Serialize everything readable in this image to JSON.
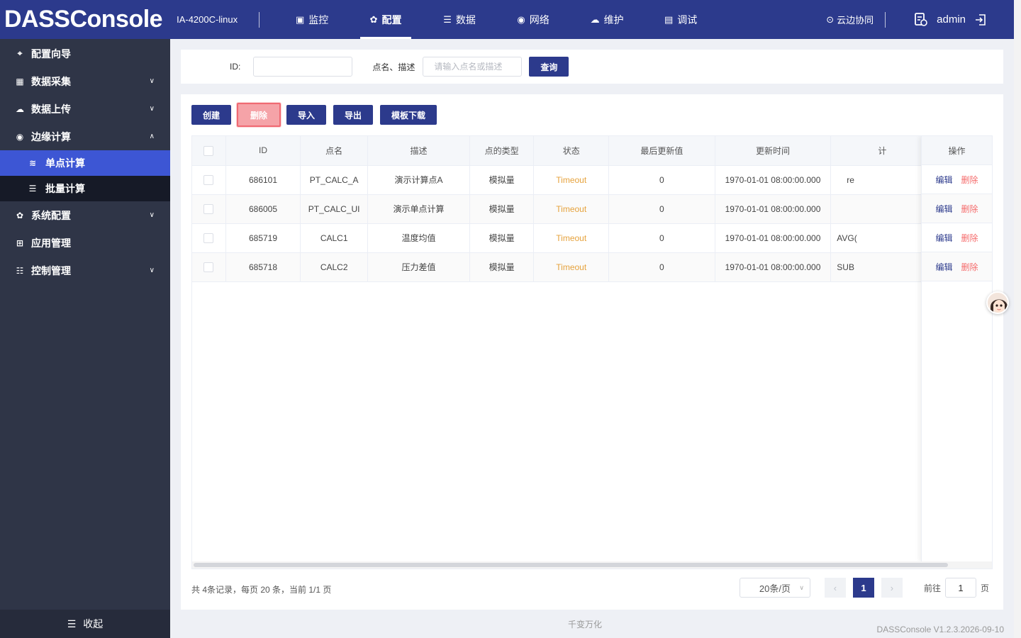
{
  "header": {
    "logo": "DASSConsole",
    "device": "IA-4200C-linux",
    "nav": [
      {
        "label": "监控",
        "icon": "monitor-icon"
      },
      {
        "label": "配置",
        "icon": "config-icon",
        "active": true
      },
      {
        "label": "数据",
        "icon": "database-icon"
      },
      {
        "label": "网络",
        "icon": "network-icon"
      },
      {
        "label": "维护",
        "icon": "maintenance-icon"
      },
      {
        "label": "调试",
        "icon": "debug-icon"
      }
    ],
    "cloud": "云边协同",
    "user": "admin"
  },
  "sidebar": {
    "items": [
      {
        "label": "配置向导",
        "icon": "wizard-icon"
      },
      {
        "label": "数据采集",
        "icon": "collect-icon"
      },
      {
        "label": "数据上传",
        "icon": "upload-icon"
      },
      {
        "label": "边缘计算",
        "icon": "edge-icon",
        "expanded": true
      },
      {
        "label": "单点计算",
        "icon": "single-calc-icon",
        "active": true
      },
      {
        "label": "批量计算",
        "icon": "batch-calc-icon"
      },
      {
        "label": "系统配置",
        "icon": "system-icon"
      },
      {
        "label": "应用管理",
        "icon": "apps-icon"
      },
      {
        "label": "控制管理",
        "icon": "control-icon"
      }
    ],
    "collapse": "收起"
  },
  "filter": {
    "id_label": "ID:",
    "id_value": "",
    "name_label": "点名、描述",
    "name_placeholder": "请输入点名或描述",
    "query": "查询"
  },
  "toolbar": {
    "create": "创建",
    "delete": "删除",
    "import": "导入",
    "export": "导出",
    "template": "模板下载"
  },
  "table": {
    "headers": [
      "ID",
      "点名",
      "描述",
      "点的类型",
      "状态",
      "最后更新值",
      "更新时间",
      "计"
    ],
    "action_header": "操作",
    "rows": [
      {
        "id": "686101",
        "name": "PT_CALC_A",
        "desc": "演示计算点A",
        "type": "模拟量",
        "status": "Timeout",
        "value": "0",
        "time": "1970-01-01 08:00:00.000",
        "formula": "re"
      },
      {
        "id": "686005",
        "name": "PT_CALC_UI",
        "desc": "演示单点计算",
        "type": "模拟量",
        "status": "Timeout",
        "value": "0",
        "time": "1970-01-01 08:00:00.000",
        "formula": ""
      },
      {
        "id": "685719",
        "name": "CALC1",
        "desc": "温度均值",
        "type": "模拟量",
        "status": "Timeout",
        "value": "0",
        "time": "1970-01-01 08:00:00.000",
        "formula": "AVG("
      },
      {
        "id": "685718",
        "name": "CALC2",
        "desc": "压力差值",
        "type": "模拟量",
        "status": "Timeout",
        "value": "0",
        "time": "1970-01-01 08:00:00.000",
        "formula": "SUB"
      }
    ],
    "edit": "编辑",
    "delete": "删除"
  },
  "pagination": {
    "summary": "共 4条记录，每页 20 条，当前 1/1 页",
    "page_size": "20条/页",
    "current": "1",
    "goto_label": "前往",
    "goto_value": "1",
    "page_suffix": "页"
  },
  "footer": {
    "center": "千变万化",
    "version": "DASSConsole V1.2.3.2026-09-10"
  },
  "colors": {
    "header": "#2c3a8c",
    "sidebar": "#2f3547",
    "active": "#3d56d4",
    "timeout": "#e6a23c",
    "danger": "#f56c6c"
  }
}
